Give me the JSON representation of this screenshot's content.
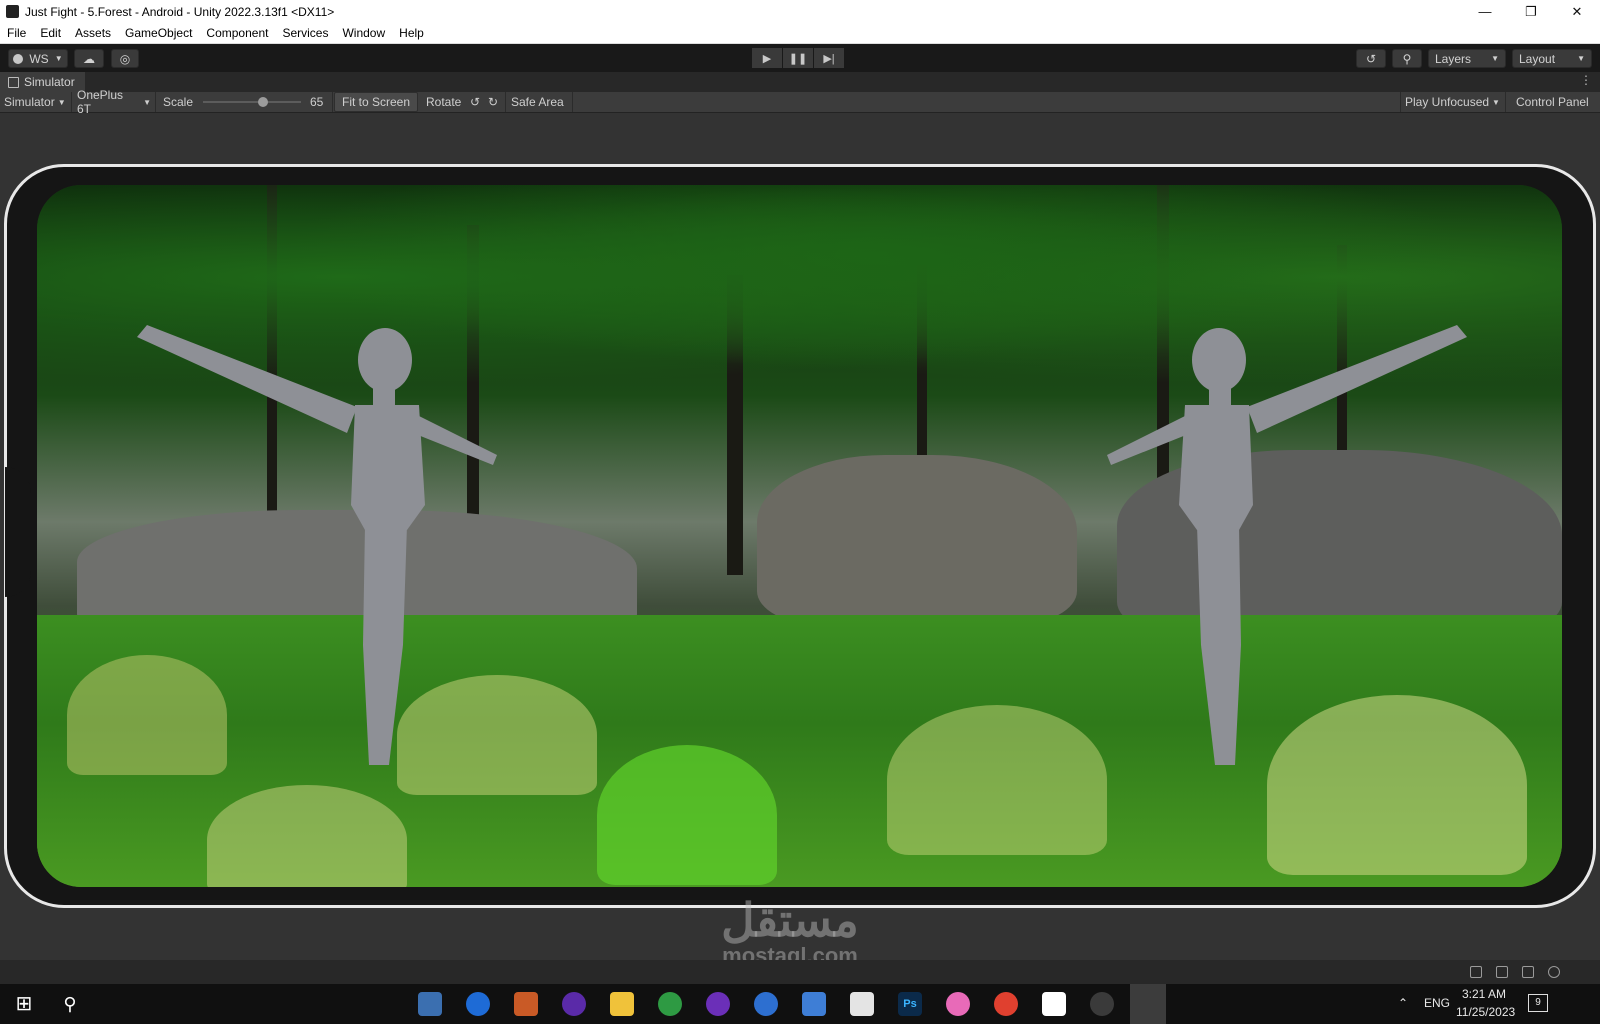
{
  "window": {
    "title": "Just Fight - 5.Forest - Android - Unity 2022.3.13f1 <DX11>",
    "min_icon": "minimize-icon",
    "max_icon": "restore-icon",
    "close_icon": "close-icon"
  },
  "menu": [
    "File",
    "Edit",
    "Assets",
    "GameObject",
    "Component",
    "Services",
    "Window",
    "Help"
  ],
  "toolbar": {
    "account_label": "WS",
    "layers_label": "Layers",
    "layout_label": "Layout"
  },
  "tab": {
    "label": "Simulator"
  },
  "simulator": {
    "mode_label": "Simulator",
    "device_label": "OnePlus 6T",
    "scale_label": "Scale",
    "scale_value": "65",
    "fit_label": "Fit to Screen",
    "rotate_label": "Rotate",
    "safe_area_label": "Safe Area",
    "play_mode_label": "Play Unfocused",
    "control_panel_label": "Control Panel"
  },
  "watermark": {
    "arabic": "مستقل",
    "latin": "mostaql.com"
  },
  "taskbar": {
    "language": "ENG",
    "time": "3:21 AM",
    "date": "11/25/2023",
    "notification_count": "9"
  },
  "colors": {
    "editor_bg": "#383838",
    "toolbar_bg": "#191919",
    "taskbar_bg": "#101010"
  }
}
